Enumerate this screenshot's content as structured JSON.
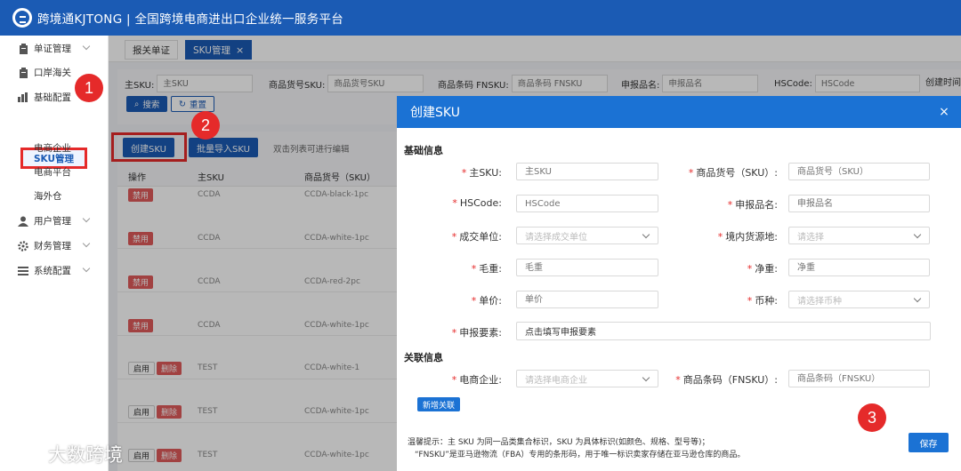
{
  "header": {
    "title": "跨境通KJTONG | 全国跨境电商进出口企业统一服务平台"
  },
  "sidebar": {
    "items": [
      {
        "label": "单证管理",
        "icon": "clipboard-icon"
      },
      {
        "label": "口岸海关",
        "icon": "clipboard-icon"
      },
      {
        "label": "基础配置",
        "icon": "bar-chart-icon"
      },
      {
        "label": "用户管理",
        "icon": "user-icon"
      },
      {
        "label": "财务管理",
        "icon": "gear-icon"
      },
      {
        "label": "系统配置",
        "icon": "list-icon"
      }
    ],
    "sub_items": [
      "SKU管理",
      "电商企业",
      "电商平台",
      "海外仓"
    ]
  },
  "tabs": [
    {
      "label": "报关单证"
    },
    {
      "label": "SKU管理",
      "close": "×"
    }
  ],
  "filters": {
    "master_sku": {
      "label": "主SKU:",
      "placeholder": "主SKU"
    },
    "product_no": {
      "label": "商品货号SKU:",
      "placeholder": "商品货号SKU"
    },
    "fnsku": {
      "label": "商品条码 FNSKU:",
      "placeholder": "商品条码 FNSKU"
    },
    "decl_name": {
      "label": "申报品名:",
      "placeholder": "申报品名"
    },
    "hscode": {
      "label": "HSCode:",
      "placeholder": "HSCode"
    },
    "created": {
      "label": "创建时间"
    },
    "search_btn": "搜索",
    "reset_btn": "重置"
  },
  "toolbar": {
    "create_btn": "创建SKU",
    "import_btn": "批量导入SKU",
    "hint": "双击列表可进行编辑"
  },
  "table": {
    "headers": [
      "操作",
      "主SKU",
      "商品货号（SKU）"
    ],
    "rows": [
      {
        "actions": [
          "禁用"
        ],
        "master": "CCDA",
        "sku": "CCDA-black-1pc"
      },
      {
        "actions": [
          "禁用"
        ],
        "master": "CCDA",
        "sku": "CCDA-white-1pc"
      },
      {
        "actions": [
          "禁用"
        ],
        "master": "CCDA",
        "sku": "CCDA-red-2pc"
      },
      {
        "actions": [
          "禁用"
        ],
        "master": "CCDA",
        "sku": "CCDA-white-1pc"
      },
      {
        "actions": [
          "启用",
          "删除"
        ],
        "master": "TEST",
        "sku": "CCDA-white-1"
      },
      {
        "actions": [
          "启用",
          "删除"
        ],
        "master": "TEST",
        "sku": "CCDA-white-1pc"
      },
      {
        "actions": [
          "启用",
          "删除"
        ],
        "master": "TEST",
        "sku": "CCDA-white-1pc"
      }
    ]
  },
  "modal": {
    "title": "创建SKU",
    "close": "×",
    "basic_section": "基础信息",
    "link_section": "关联信息",
    "fields": {
      "master_sku": {
        "label": "主SKU:",
        "placeholder": "主SKU"
      },
      "product_no": {
        "label": "商品货号（SKU）:",
        "placeholder": "商品货号（SKU）"
      },
      "hscode": {
        "label": "HSCode:",
        "placeholder": "HSCode"
      },
      "decl_name": {
        "label": "申报品名:",
        "placeholder": "申报品名"
      },
      "unit": {
        "label": "成交单位:",
        "placeholder": "请选择成交单位"
      },
      "origin": {
        "label": "境内货源地:",
        "placeholder": "请选择"
      },
      "gross": {
        "label": "毛重:",
        "placeholder": "毛重"
      },
      "net": {
        "label": "净重:",
        "placeholder": "净重"
      },
      "price": {
        "label": "单价:",
        "placeholder": "单价"
      },
      "currency": {
        "label": "币种:",
        "placeholder": "请选择币种"
      },
      "elements": {
        "label": "申报要素:",
        "placeholder": "点击填写申报要素"
      },
      "company": {
        "label": "电商企业:",
        "placeholder": "请选择电商企业"
      },
      "fnsku": {
        "label": "商品条码（FNSKU）:",
        "placeholder": "商品条码（FNSKU）"
      }
    },
    "add_link_btn": "新增关联",
    "tip_line1": "温馨提示：主 SKU 为同一品类集合标识，SKU 为具体标识(如颜色、规格、型号等)；",
    "tip_line2": "“FNSKU”是亚马逊物流（FBA）专用的条形码，用于唯一标识卖家存储在亚马逊仓库的商品。",
    "save_btn": "保存"
  },
  "annotations": [
    "1",
    "2",
    "3"
  ],
  "watermark": "大数跨境",
  "colors": {
    "brand": "#1b5bb4",
    "modal_header": "#1b72d4",
    "highlight": "#e52a2a"
  }
}
